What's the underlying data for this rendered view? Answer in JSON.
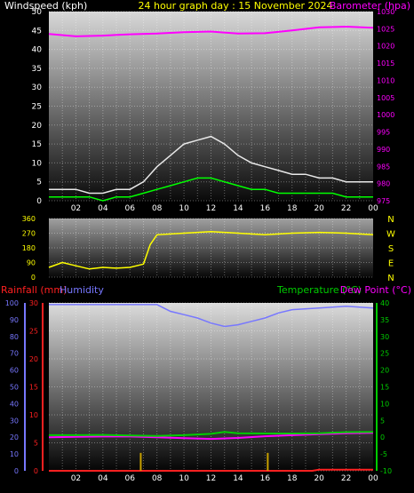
{
  "header": {
    "wind_title": "Windspeed (kph)",
    "graph_title": "24 hour graph day : 15 November 2024",
    "baro_title": "Barometer (hpa)"
  },
  "bottom_header": {
    "rainfall_title": "Rainfall (mm)",
    "humidity_title": "Humidity",
    "temperature_title": "Temperature (°C)",
    "dewpoint_title": "Dew Point (°C)"
  },
  "colors": {
    "wind_gust": "#e8e8e8",
    "wind_avg": "#00ff00",
    "barometer": "#ff00ff",
    "direction": "#ffff00",
    "rainfall": "#ff2020",
    "humidity": "#7777ff",
    "temperature": "#00cc00",
    "dewpoint": "#ff00ff",
    "rain_bar": "#c8a000"
  },
  "chart_data": [
    {
      "type": "line",
      "name": "wind-barometer",
      "x_ticks": [
        "02",
        "04",
        "06",
        "08",
        "10",
        "12",
        "14",
        "16",
        "18",
        "20",
        "22",
        "00"
      ],
      "x_range_hours": [
        0,
        24
      ],
      "ylabel_left": "Windspeed (kph)",
      "ylim_left": [
        0,
        50
      ],
      "yticks_left": [
        0,
        5,
        10,
        15,
        20,
        25,
        30,
        35,
        40,
        45,
        50
      ],
      "ylabel_right": "Barometer (hpa)",
      "ylim_right": [
        975,
        1030
      ],
      "yticks_right": [
        975,
        980,
        985,
        990,
        995,
        1000,
        1005,
        1010,
        1015,
        1020,
        1025,
        1030
      ],
      "series": [
        {
          "key": "gust",
          "hours": [
            0,
            1,
            2,
            3,
            4,
            5,
            6,
            7,
            8,
            9,
            10,
            11,
            12,
            13,
            14,
            15,
            16,
            17,
            18,
            19,
            20,
            21,
            22,
            23,
            24
          ],
          "values": [
            3,
            3,
            3,
            2,
            2,
            3,
            3,
            5,
            9,
            12,
            15,
            16,
            17,
            15,
            12,
            10,
            9,
            8,
            7,
            7,
            6,
            6,
            5,
            5,
            5
          ]
        },
        {
          "key": "avg",
          "hours": [
            0,
            1,
            2,
            3,
            4,
            5,
            6,
            7,
            8,
            9,
            10,
            11,
            12,
            13,
            14,
            15,
            16,
            17,
            18,
            19,
            20,
            21,
            22,
            23,
            24
          ],
          "values": [
            1,
            1,
            1,
            1,
            0,
            1,
            1,
            2,
            3,
            4,
            5,
            6,
            6,
            5,
            4,
            3,
            3,
            2,
            2,
            2,
            2,
            2,
            1,
            1,
            1
          ]
        },
        {
          "key": "barometer",
          "hours": [
            0,
            2,
            4,
            6,
            8,
            10,
            12,
            14,
            16,
            18,
            20,
            22,
            24
          ],
          "values": [
            1023.5,
            1022.8,
            1023.0,
            1023.4,
            1023.6,
            1024.0,
            1024.2,
            1023.6,
            1023.7,
            1024.5,
            1025.4,
            1025.6,
            1025.3
          ]
        }
      ]
    },
    {
      "type": "line",
      "name": "wind-direction",
      "ylim": [
        0,
        360
      ],
      "yticks": [
        0,
        90,
        180,
        270,
        360
      ],
      "compass_labels": [
        "N",
        "W",
        "S",
        "E",
        "N"
      ],
      "series": [
        {
          "key": "direction",
          "hours": [
            0,
            1,
            2,
            3,
            4,
            5,
            6,
            7,
            7.5,
            8,
            10,
            12,
            14,
            16,
            18,
            20,
            22,
            24
          ],
          "values": [
            60,
            90,
            70,
            50,
            60,
            55,
            60,
            80,
            200,
            260,
            270,
            280,
            270,
            260,
            270,
            275,
            270,
            260
          ]
        }
      ]
    },
    {
      "type": "line",
      "name": "rain-humidity-temp",
      "ylabel_rain": "Rainfall (mm)",
      "ylim_rain": [
        0,
        30
      ],
      "yticks_rain": [
        0,
        5,
        10,
        15,
        20,
        25,
        30
      ],
      "ylabel_humidity": "Humidity",
      "ylim_humidity": [
        0,
        100
      ],
      "yticks_humidity": [
        0,
        10,
        20,
        30,
        40,
        50,
        60,
        70,
        80,
        90,
        100
      ],
      "ylabel_temp": "Temperature (°C)",
      "ylim_temp": [
        -10,
        40
      ],
      "yticks_temp": [
        -10,
        -5,
        0,
        5,
        10,
        15,
        20,
        25,
        30,
        35,
        40
      ],
      "series": [
        {
          "key": "humidity",
          "hours": [
            0,
            2,
            4,
            6,
            8,
            9,
            10,
            11,
            12,
            13,
            14,
            15,
            16,
            17,
            18,
            20,
            22,
            24
          ],
          "values": [
            99,
            99,
            99,
            99,
            99,
            95,
            93,
            91,
            88,
            86,
            87,
            89,
            91,
            94,
            96,
            97,
            98,
            97
          ]
        },
        {
          "key": "temperature",
          "hours": [
            0,
            2,
            4,
            6,
            8,
            10,
            12,
            13,
            14,
            16,
            18,
            20,
            22,
            24
          ],
          "values": [
            0.6,
            0.6,
            0.7,
            0.5,
            0.4,
            0.6,
            1.0,
            1.6,
            1.2,
            1.1,
            1.1,
            1.2,
            1.5,
            1.6
          ]
        },
        {
          "key": "dewpoint",
          "hours": [
            0,
            2,
            4,
            6,
            8,
            10,
            12,
            14,
            16,
            18,
            20,
            22,
            24
          ],
          "values": [
            0.0,
            0.1,
            0.2,
            0.2,
            0.0,
            -0.3,
            -0.5,
            -0.2,
            0.3,
            0.6,
            0.9,
            1.2,
            1.3
          ]
        },
        {
          "key": "rainfall",
          "hours": [
            0,
            19.5,
            20,
            24
          ],
          "values": [
            0.0,
            0.0,
            0.2,
            0.2
          ]
        },
        {
          "key": "rain_rate",
          "hours": [
            6.8,
            16.2
          ],
          "values": [
            3.2,
            3.2
          ]
        }
      ]
    }
  ]
}
